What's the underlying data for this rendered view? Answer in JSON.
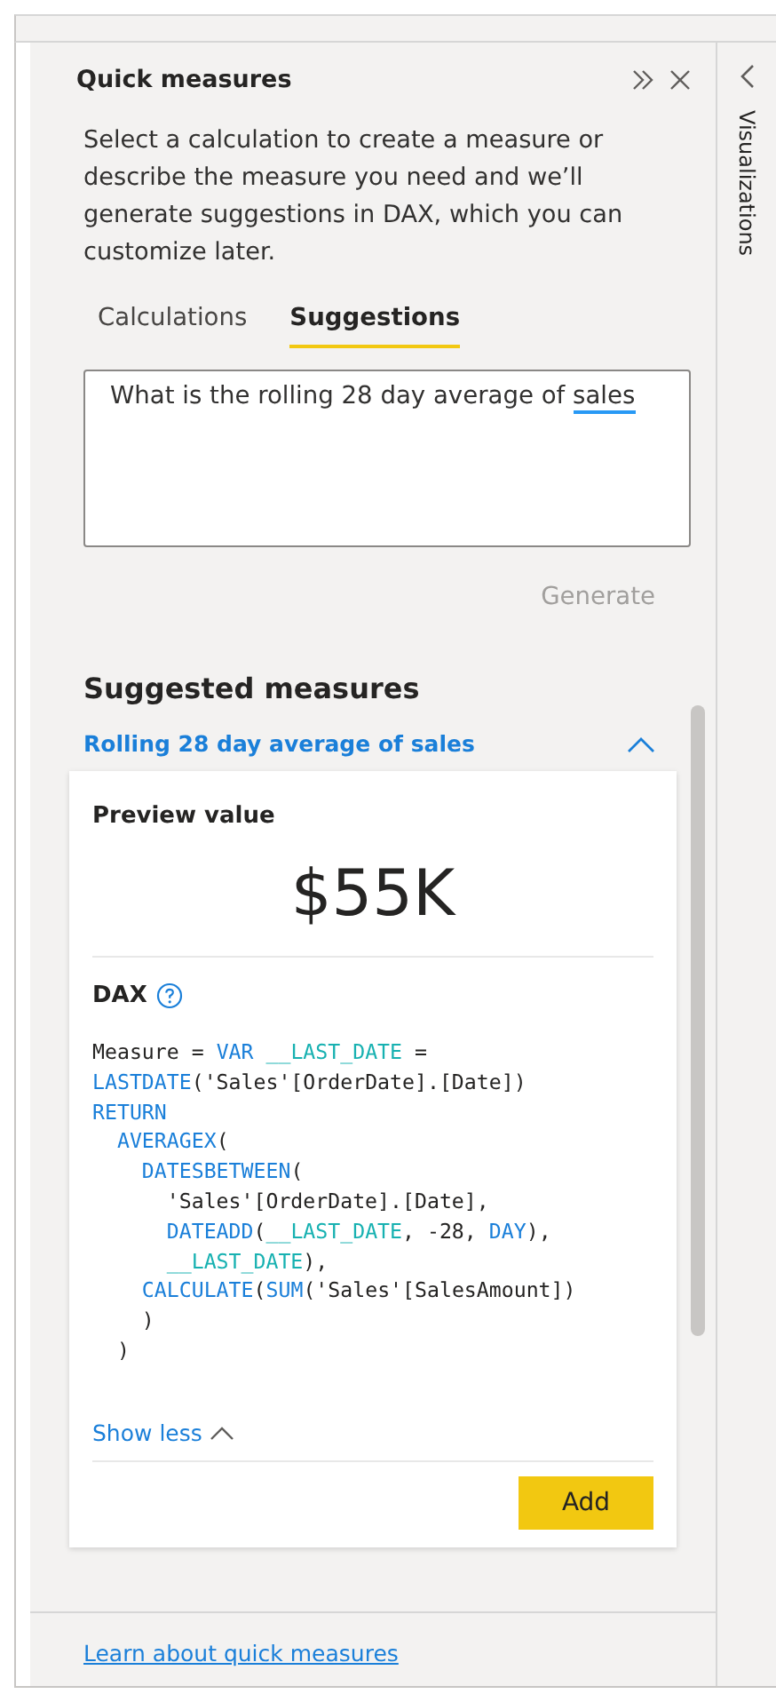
{
  "panel": {
    "title": "Quick measures",
    "description": "Select a calculation to create a measure or describe the measure you need and we’ll generate suggestions in DAX, which you can customize later.",
    "tabs": [
      {
        "label": "Calculations",
        "selected": false
      },
      {
        "label": "Suggestions",
        "selected": true
      }
    ],
    "question": {
      "segments": [
        {
          "text": "What is the rolling 28 day average of ",
          "flagged": false
        },
        {
          "text": "sales",
          "flagged": true
        }
      ]
    },
    "generate_button": {
      "label": "Generate",
      "disabled": true
    },
    "suggested_heading": "Suggested measures",
    "suggestion": {
      "title": "Rolling 28 day average of sales",
      "expanded": true,
      "preview_label": "Preview value",
      "preview_value": "$55K",
      "dax_heading": "DAX",
      "code_lines": [
        [
          {
            "text": "Measure = ",
            "kind": "plain"
          },
          {
            "text": "VAR ",
            "kind": "keyword"
          },
          {
            "text": "__LAST_DATE",
            "kind": "variable"
          },
          {
            "text": " =",
            "kind": "plain"
          }
        ],
        [
          {
            "text": "LASTDATE",
            "kind": "keyword"
          },
          {
            "text": "('Sales'[OrderDate].[Date])",
            "kind": "plain"
          }
        ],
        [
          {
            "text": "RETURN",
            "kind": "keyword"
          }
        ],
        [
          {
            "text": "  AVERAGEX",
            "kind": "keyword"
          },
          {
            "text": "(",
            "kind": "plain"
          }
        ],
        [
          {
            "text": "    DATESBETWEEN",
            "kind": "keyword"
          },
          {
            "text": "(",
            "kind": "plain"
          }
        ],
        [
          {
            "text": "      'Sales'[OrderDate].[Date],",
            "kind": "plain"
          }
        ],
        [
          {
            "text": "      DATEADD",
            "kind": "keyword"
          },
          {
            "text": "(",
            "kind": "plain"
          },
          {
            "text": "__LAST_DATE",
            "kind": "variable"
          },
          {
            "text": ", -28, ",
            "kind": "plain"
          },
          {
            "text": "DAY",
            "kind": "keyword"
          },
          {
            "text": "),",
            "kind": "plain"
          }
        ],
        [
          {
            "text": "      __LAST_DATE",
            "kind": "variable"
          },
          {
            "text": "),",
            "kind": "plain"
          }
        ],
        [
          {
            "text": "    CALCULATE",
            "kind": "keyword"
          },
          {
            "text": "(",
            "kind": "plain"
          },
          {
            "text": "SUM",
            "kind": "keyword"
          },
          {
            "text": "('Sales'[SalesAmount])",
            "kind": "plain"
          }
        ],
        [
          {
            "text": "    )",
            "kind": "plain"
          }
        ],
        [
          {
            "text": "  )",
            "kind": "plain"
          }
        ]
      ],
      "show_less": "Show less",
      "add_button": "Add"
    },
    "footer_link": "Learn about quick measures"
  },
  "side_pane": {
    "title": "Visualizations"
  }
}
